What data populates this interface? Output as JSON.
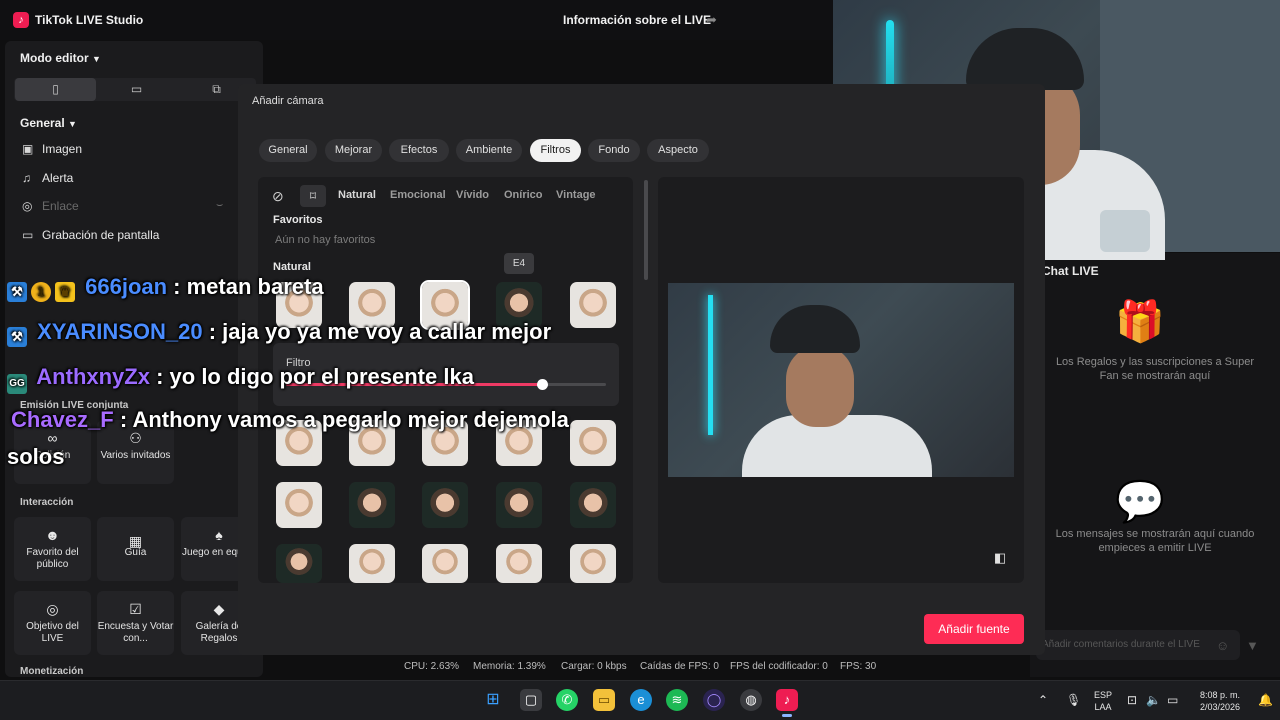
{
  "app": {
    "title": "TikTok LIVE Studio",
    "live_info": "Información sobre el LIVE",
    "logo_glyph": "♪",
    "accent": "#fe2c55"
  },
  "sidebar": {
    "mode": "Modo editor",
    "general_label": "General",
    "items": [
      {
        "label": "Imagen",
        "icon": "image-icon",
        "glyph": "▣"
      },
      {
        "label": "Alerta",
        "icon": "bell-icon",
        "glyph": "♫"
      },
      {
        "label": "Enlace",
        "icon": "globe-icon",
        "glyph": "◎"
      },
      {
        "label": "Grabación de pantalla",
        "icon": "monitor-icon",
        "glyph": "▭"
      }
    ],
    "cohost_heading": "Emisión LIVE conjunta",
    "cohost_tiles": [
      {
        "label": "Colisión",
        "icon": "link-icon",
        "glyph": "∞"
      },
      {
        "label": "Varios invitados",
        "icon": "users-icon",
        "glyph": "👥"
      }
    ],
    "interaction_heading": "Interacción",
    "interaction_tiles": [
      {
        "label": "Favorito del público",
        "icon": "star-person-icon",
        "glyph": "☻"
      },
      {
        "label": "Guía",
        "icon": "guide-icon",
        "glyph": "▦"
      },
      {
        "label": "Juego en equipo",
        "icon": "joystick-icon",
        "glyph": "♠"
      },
      {
        "label": "Objetivo del LIVE",
        "icon": "target-icon",
        "glyph": "◎"
      },
      {
        "label": "Encuesta y Votar con...",
        "icon": "poll-icon",
        "glyph": "☑"
      },
      {
        "label": "Galería de Regalos",
        "icon": "gallery-icon",
        "glyph": "◆"
      }
    ],
    "monetization_heading": "Monetización"
  },
  "modal": {
    "title": "Añadir cámara",
    "tabs": [
      "General",
      "Mejorar",
      "Efectos",
      "Ambiente",
      "Filtros",
      "Fondo",
      "Aspecto"
    ],
    "active_tab": "Filtros",
    "filter_tabs": [
      "Natural",
      "Emocional",
      "Vívido",
      "Onírico",
      "Vintage"
    ],
    "favorites_heading": "Favoritos",
    "favorites_empty": "Aún no hay favoritos",
    "natural_heading": "Natural",
    "tooltip": "E4",
    "slider_label": "Filtro",
    "slider_value": 0.8,
    "add_button": "Añadir fuente"
  },
  "chat": {
    "title": "Chat LIVE",
    "gifts_text": "Los Regalos y las suscripciones a Super Fan se mostrarán aquí",
    "messages_text": "Los mensajes se mostrarán aquí cuando empieces a emitir LIVE",
    "input_placeholder": "Añadir comentarios durante el LIVE"
  },
  "stats": {
    "cpu": "CPU:  2.63%",
    "memory": "Memoria:  1.39%",
    "upload": "Cargar:  0 kbps",
    "fps_drops": "Caídas de FPS:  0",
    "encoder_drops": "FPS del codificador:  0",
    "fps": "FPS:  30"
  },
  "overlay_chat": [
    {
      "user": "666joan",
      "message": " : metan bareta",
      "color": "#4a8cff",
      "badges": [
        "⚒",
        "1",
        "♛"
      ]
    },
    {
      "user": "XYARINSON_20",
      "message": " : jaja yo ya me voy a callar mejor",
      "color": "#4a8cff",
      "badges": [
        "⚒"
      ]
    },
    {
      "user": "AnthxnyZx",
      "message": " : yo lo digo por el presente lka",
      "color": "#9b6bff",
      "badges": [
        "GG"
      ]
    },
    {
      "user": "Chavez_F",
      "message": " : Anthony vamos a pegarlo mejor dejemola",
      "color": "#a86bff",
      "badges": []
    },
    {
      "user": "",
      "message": "solos",
      "color": "#ffffff",
      "badges": []
    }
  ],
  "taskbar": {
    "apps": [
      "windows-icon",
      "task-view-icon",
      "whatsapp-icon",
      "file-explorer-icon",
      "edge-icon",
      "spotify-icon",
      "obs-ring-icon",
      "chrome-like-icon",
      "tiktok-icon"
    ],
    "lang_top": "ESP",
    "lang_bottom": "LAA",
    "time": "8:08 p. m.",
    "date": "2/03/2026"
  }
}
